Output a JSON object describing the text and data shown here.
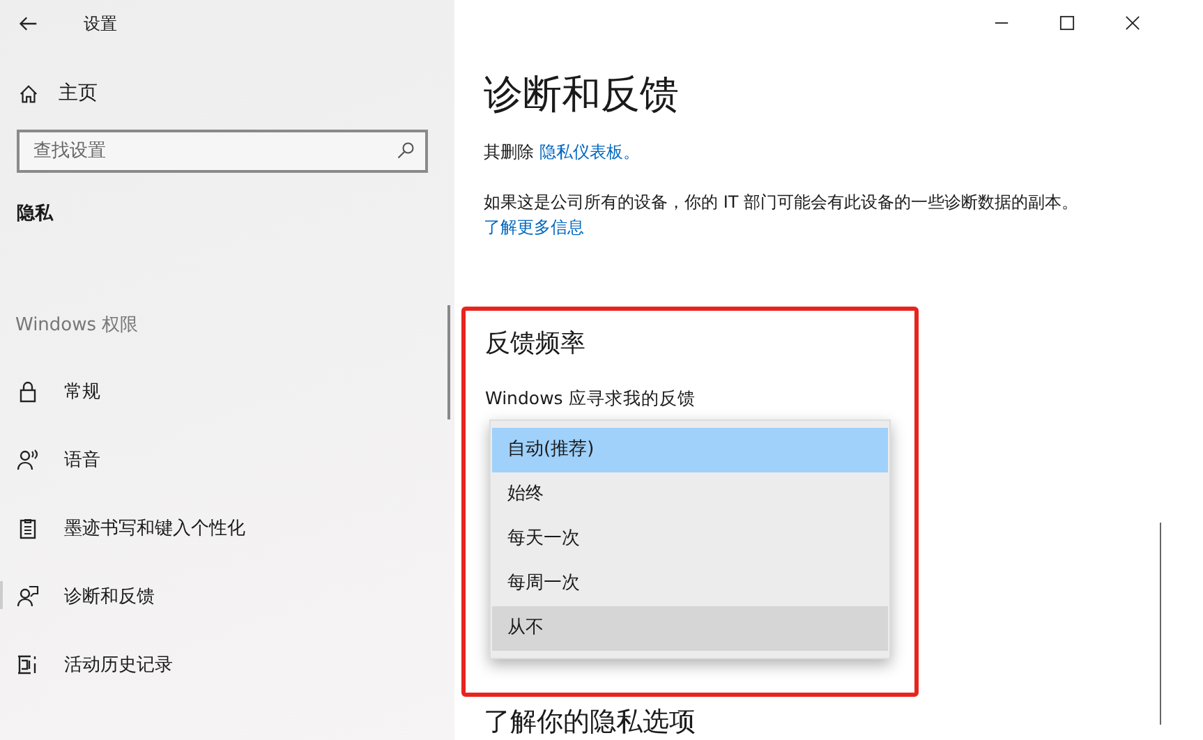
{
  "window": {
    "title": "设置"
  },
  "sidebar": {
    "home": "主页",
    "search": {
      "placeholder": "查找设置"
    },
    "section": "隐私",
    "group": "Windows 权限",
    "items": [
      {
        "label": "常规",
        "selected": false
      },
      {
        "label": "语音",
        "selected": false
      },
      {
        "label": "墨迹书写和键入个性化",
        "selected": false
      },
      {
        "label": "诊断和反馈",
        "selected": true
      },
      {
        "label": "活动历史记录",
        "selected": false
      }
    ]
  },
  "page": {
    "title": "诊断和反馈",
    "paragraphs": [
      {
        "text": "其删除 ",
        "link": "隐私仪表板。"
      },
      {
        "text": "如果这是公司所有的设备，你的 IT 部门可能会有此设备的一些诊断数据的副本。 ",
        "link": "了解更多信息"
      }
    ],
    "section": {
      "title": "反馈频率",
      "label": "Windows 应寻求我的反馈",
      "options": [
        {
          "label": "自动(推荐)",
          "selected": true,
          "hovered": false
        },
        {
          "label": "始终",
          "selected": false,
          "hovered": false
        },
        {
          "label": "每天一次",
          "selected": false,
          "hovered": false
        },
        {
          "label": "每周一次",
          "selected": false,
          "hovered": false
        },
        {
          "label": "从不",
          "selected": false,
          "hovered": true
        }
      ]
    },
    "next_heading": "了解你的隐私选项"
  }
}
